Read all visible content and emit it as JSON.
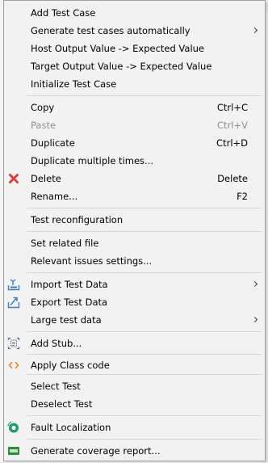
{
  "menu": {
    "add_test_case": "Add Test Case",
    "generate_auto": "Generate test cases automatically",
    "host_output": "Host Output Value -> Expected Value",
    "target_output": "Target Output Value -> Expected Value",
    "initialize": "Initialize Test Case",
    "copy": {
      "label": "Copy",
      "shortcut": "Ctrl+C"
    },
    "paste": {
      "label": "Paste",
      "shortcut": "Ctrl+V"
    },
    "duplicate": {
      "label": "Duplicate",
      "shortcut": "Ctrl+D"
    },
    "duplicate_multiple": "Duplicate multiple times...",
    "delete": {
      "label": "Delete",
      "shortcut": "Delete"
    },
    "rename": {
      "label": "Rename...",
      "shortcut": "F2"
    },
    "test_reconfig": "Test reconfiguration",
    "set_related_file": "Set related file",
    "relevant_issues": "Relevant issues settings...",
    "import_test_data": "Import Test Data",
    "export_test_data": "Export Test Data",
    "large_test_data": "Large test data",
    "add_stub": "Add Stub...",
    "apply_class_code": "Apply Class code",
    "select_test": "Select Test",
    "deselect_test": "Deselect Test",
    "fault_localization": "Fault Localization",
    "generate_coverage": "Generate coverage report..."
  },
  "icons": {
    "delete": "red-x-icon",
    "import": "import-data-icon",
    "export": "export-data-icon",
    "stub": "add-stub-icon",
    "class_code": "code-brackets-icon",
    "fault": "fault-localization-icon",
    "coverage": "csv-report-icon"
  },
  "colors": {
    "menu_bg": "#f2f2f2",
    "disabled_text": "#8f8f8f",
    "delete_icon": "#e23b3b",
    "class_code_icon": "#e0872d",
    "fault_icon": "#1e9e67",
    "coverage_icon": "#2d8a3e",
    "data_icon": "#3b7fc4"
  }
}
